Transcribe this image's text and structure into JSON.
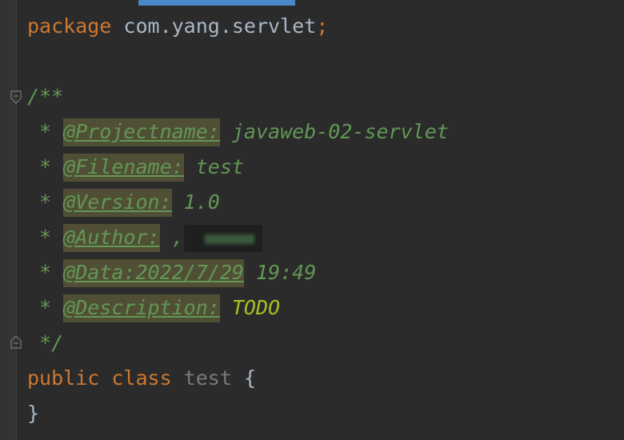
{
  "code": {
    "line1": {
      "keyword": "package",
      "path": "com.yang.servlet",
      "semicolon": ";"
    },
    "line3": {
      "comment_open": "/**"
    },
    "doc_tags": {
      "projectname": {
        "prefix": " * ",
        "tag": "@Projectname:",
        "value": " javaweb-02-servlet"
      },
      "filename": {
        "prefix": " * ",
        "tag": "@Filename:",
        "value": " test"
      },
      "version": {
        "prefix": " * ",
        "tag": "@Version:",
        "value": " 1.0"
      },
      "author": {
        "prefix": " * ",
        "tag": "@Author:",
        "value": " ,"
      },
      "data": {
        "prefix": " * ",
        "tag": "@Data:2022/7/29",
        "value": " 19:49"
      },
      "description": {
        "prefix": " * ",
        "tag": "@Description:",
        "value": " TODO"
      }
    },
    "comment_close": " */",
    "class_line": {
      "modifier": "public",
      "keyword": "class",
      "name": "test",
      "brace": "{"
    },
    "closing_brace": "}"
  }
}
